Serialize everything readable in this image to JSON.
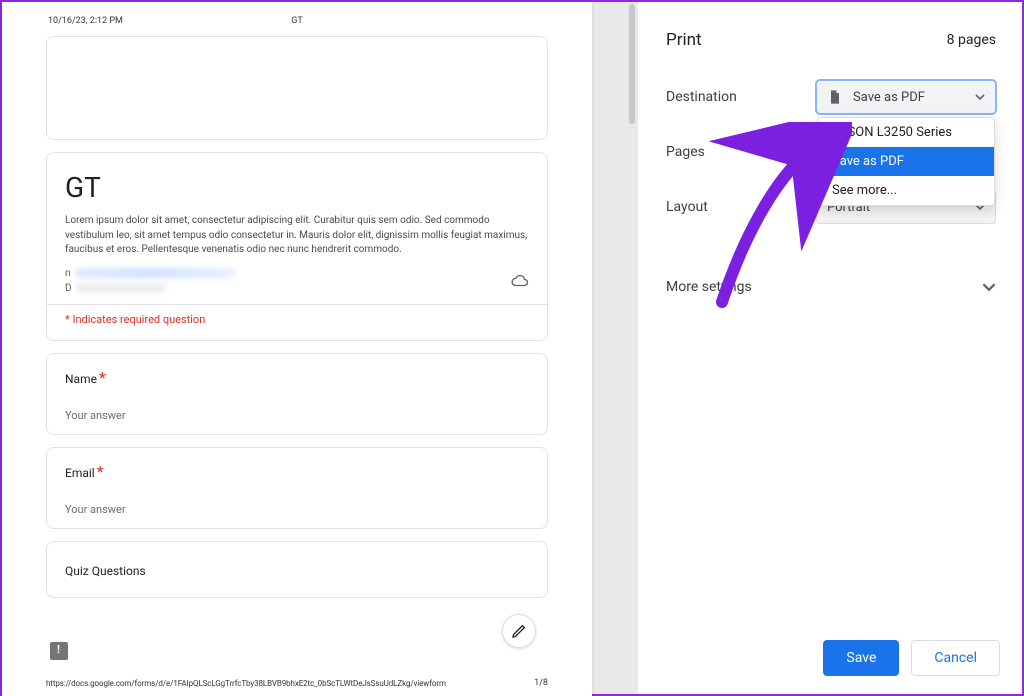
{
  "preview": {
    "timestamp": "10/16/23, 2:12 PM",
    "header_center": "GT",
    "form_title": "GT",
    "form_desc": "Lorem ipsum dolor sit amet, consectetur adipiscing elit. Curabitur quis sem odio. Sed commodo vestibulum leo, sit amet tempus odio consectetur in. Mauris dolor elit, dignissim mollis feugiat maximus, faucibus et eros. Pellentesque venenatis odio nec nunc hendrerit commodo.",
    "required_note": "* Indicates required question",
    "questions": [
      {
        "label": "Name",
        "required": true,
        "placeholder": "Your answer"
      },
      {
        "label": "Email",
        "required": true,
        "placeholder": "Your answer"
      }
    ],
    "section_label": "Quiz Questions",
    "footer_url": "https://docs.google.com/forms/d/e/1FAIpQLScLGgTrrfcTby38LBVB9bhxE2tc_0bScTLWtDeJsSsuUdLZkg/viewform",
    "footer_page": "1/8"
  },
  "panel": {
    "title": "Print",
    "page_count": "8 pages",
    "destination_label": "Destination",
    "destination_value": "Save as PDF",
    "destination_options": [
      "EPSON L3250 Series",
      "Save as PDF",
      "See more..."
    ],
    "pages_label": "Pages",
    "layout_label": "Layout",
    "layout_value": "Portrait",
    "more_label": "More settings",
    "save_label": "Save",
    "cancel_label": "Cancel"
  }
}
